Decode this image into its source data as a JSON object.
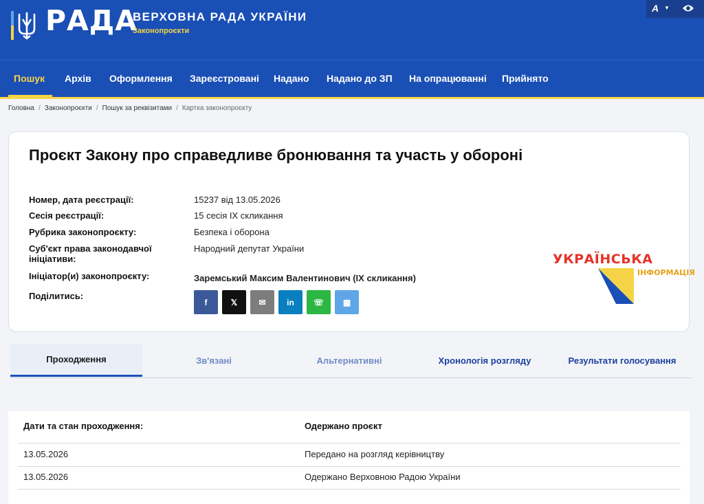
{
  "header": {
    "brand": "РАДА",
    "title": "ВЕРХОВНА РАДА УКРАЇНИ",
    "subtitle": "Законопроєкти",
    "font_size_label": "A",
    "icons": [
      "trident-icon",
      "chevron-down-icon",
      "eye-icon"
    ]
  },
  "nav": {
    "items": [
      {
        "label": "Пошук",
        "active": true
      },
      {
        "label": "Архів"
      },
      {
        "label": "Оформлення"
      },
      {
        "label": "Зареєстровані"
      },
      {
        "label": "Надано"
      },
      {
        "label": "Надано до ЗП"
      },
      {
        "label": "На опрацюванні"
      },
      {
        "label": "Прийнято"
      }
    ]
  },
  "breadcrumb": [
    "Головна",
    "Законопроєкти",
    "Пошук за реквізитами",
    "Картка законопроєкту"
  ],
  "bill": {
    "title": "Проєкт Закону про справедливе бронювання та участь у обороні",
    "fields": [
      {
        "label": "Номер, дата реєстрації:",
        "value": "15237 від 13.05.2026"
      },
      {
        "label": "Сесія реєстрації:",
        "value": "15 сесія IX скликання"
      },
      {
        "label": "Рубрика законопроєкту:",
        "value": "Безпека і оборона"
      },
      {
        "label": "Суб'єкт права законодавчої ініціативи:",
        "value": "Народний депутат України"
      },
      {
        "label": "Ініціатор(и) законопроєкту:",
        "value": "Заремський Максим Валентинович (IX скликання)"
      },
      {
        "label": "Поділитись:",
        "value": ""
      }
    ],
    "share": [
      {
        "name": "facebook",
        "glyph": "f",
        "color": "#3b5998"
      },
      {
        "name": "x",
        "glyph": "𝕏",
        "color": "#111111"
      },
      {
        "name": "email",
        "glyph": "✉",
        "color": "#7d7d7d"
      },
      {
        "name": "linkedin",
        "glyph": "in",
        "color": "#0a7fc0"
      },
      {
        "name": "whatsapp",
        "glyph": "☏",
        "color": "#2bb741"
      },
      {
        "name": "qr",
        "glyph": "▦",
        "color": "#5fa6e6"
      }
    ]
  },
  "watermark": {
    "line1": "УКРАЇНСЬКА",
    "line2": "ІНФОРМАЦІЯ"
  },
  "tabs": [
    {
      "label": "Проходження",
      "state": "active"
    },
    {
      "label": "Зв'язані",
      "state": "muted"
    },
    {
      "label": "Альтернативні",
      "state": "muted"
    },
    {
      "label": "Хронологія розгляду",
      "state": "link"
    },
    {
      "label": "Результати голосування",
      "state": "link"
    }
  ],
  "progress_table": {
    "headers": [
      "Дати та стан проходження:",
      "Одержано проєкт"
    ],
    "rows": [
      [
        "13.05.2026",
        "Передано на розгляд керівництву"
      ],
      [
        "13.05.2026",
        "Одержано Верховною Радою України"
      ]
    ]
  },
  "colors": {
    "primary": "#1a4fb5",
    "accent": "#f5d547",
    "watermark_red": "#e5332a"
  }
}
